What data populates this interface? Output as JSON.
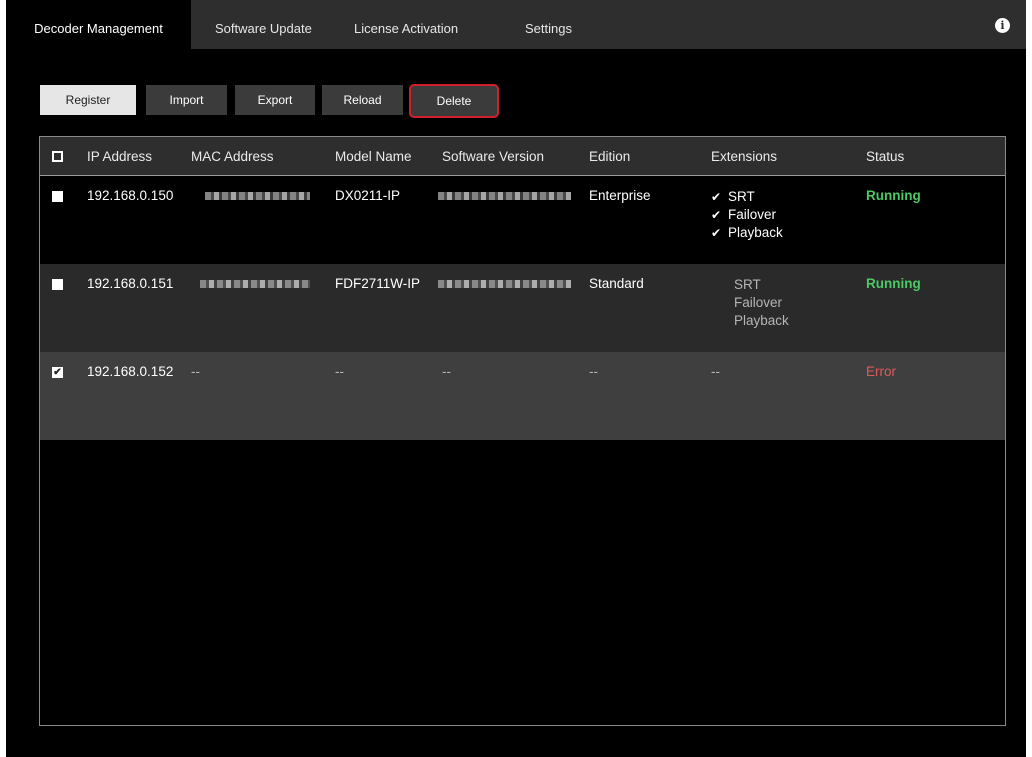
{
  "tabs": [
    {
      "label": "Decoder Management",
      "active": true
    },
    {
      "label": "Software Update",
      "active": false
    },
    {
      "label": "License Activation",
      "active": false
    },
    {
      "label": "Settings",
      "active": false
    }
  ],
  "info_icon": "info-icon",
  "toolbar": {
    "register": "Register",
    "import": "Import",
    "export": "Export",
    "reload": "Reload",
    "delete": "Delete"
  },
  "table": {
    "columns": [
      "IP Address",
      "MAC Address",
      "Model Name",
      "Software Version",
      "Edition",
      "Extensions",
      "Status"
    ],
    "rows": [
      {
        "checked": false,
        "ip": "192.168.0.150",
        "mac": "",
        "model": "DX0211-IP",
        "version": "",
        "edition": "Enterprise",
        "extensions": [
          "SRT",
          "Failover",
          "Playback"
        ],
        "extensions_enabled": true,
        "status": "Running"
      },
      {
        "checked": false,
        "ip": "192.168.0.151",
        "mac": "",
        "model": "FDF2711W-IP",
        "version": "",
        "edition": "Standard",
        "extensions": [
          "SRT",
          "Failover",
          "Playback"
        ],
        "extensions_enabled": false,
        "status": "Running"
      },
      {
        "checked": true,
        "ip": "192.168.0.152",
        "mac": "--",
        "model": "--",
        "version": "--",
        "edition": "--",
        "extensions_text": "--",
        "status": "Error"
      }
    ]
  },
  "colors": {
    "running": "#4cc864",
    "error": "#e05a5a",
    "delete_highlight": "#d0202a",
    "row_alt": "#2a2a2a",
    "row_selected": "#3f3f3f"
  }
}
